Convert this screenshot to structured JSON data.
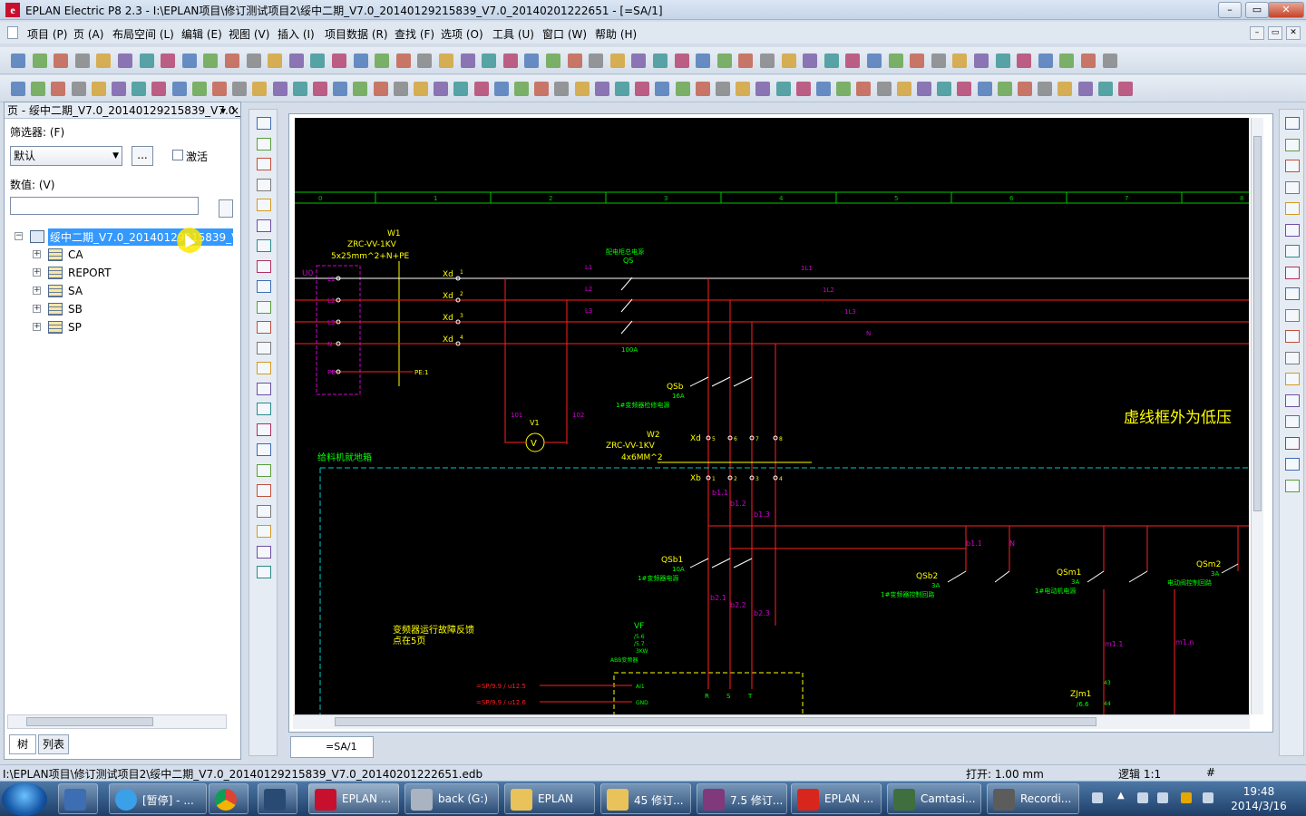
{
  "window": {
    "title": "EPLAN Electric P8 2.3 - I:\\EPLAN项目\\修订测试项目2\\绥中二期_V7.0_20140129215839_V7.0_20140201222651 - [=SA/1]"
  },
  "menu": [
    "项目 (P)",
    "页 (A)",
    "布局空间 (L)",
    "编辑 (E)",
    "视图 (V)",
    "插入 (I)",
    "项目数据 (R)",
    "查找 (F)",
    "选项 (O)",
    "工具 (U)",
    "窗口 (W)",
    "帮助 (H)"
  ],
  "panel": {
    "title": "页 - 绥中二期_V7.0_20140129215839_V7.0_20",
    "filter_label": "筛选器: (F)",
    "filter_value": "默认",
    "more_label": "...",
    "activate_label": "激活",
    "value_label": "数值: (V)",
    "tree_root": "绥中二期_V7.0_20140129215839_V7",
    "tree_items": [
      "CA",
      "REPORT",
      "SA",
      "SB",
      "SP"
    ],
    "tab_tree": "树",
    "tab_list": "列表"
  },
  "page_tab": "=SA/1",
  "status": {
    "path": "I:\\EPLAN项目\\修订测试项目2\\绥中二期_V7.0_20140129215839_V7.0_20140201222651.edb",
    "open": "打开: 1.00 mm",
    "logic": "逻辑 1:1",
    "hash": "#"
  },
  "taskbar": {
    "items": [
      "[暂停] - ...",
      "",
      "",
      "EPLAN ...",
      "back (G:)",
      "EPLAN",
      "45 修订...",
      "7.5 修订...",
      "EPLAN ...",
      "Camtasi...",
      "Recordi..."
    ],
    "time": "19:48",
    "date": "2014/3/16"
  },
  "schematic": {
    "grid_numbers": [
      "0",
      "1",
      "2",
      "3",
      "4",
      "5",
      "6",
      "7",
      "8"
    ],
    "cable_w1": [
      "W1",
      "ZRC-VV-1KV",
      "5x25mm^2+N+PE"
    ],
    "u0": "U0",
    "u0_terms": [
      "L1",
      "L2",
      "L3",
      "N",
      "PE"
    ],
    "xd_labels": [
      "Xd",
      "Xd",
      "Xd",
      "Xd"
    ],
    "xd_nums": [
      "1",
      "2",
      "3",
      "4"
    ],
    "pe_label": "PE:1",
    "qs_title": "配电柜总电源",
    "qs": "QS",
    "qs_rating": "100A",
    "phase_in": [
      "L1",
      "L2",
      "L3"
    ],
    "phase_out": [
      "1L1",
      "1L2",
      "1L3",
      "N"
    ],
    "qsb": "QSb",
    "qsb_rating": "16A",
    "qsb_desc": "1#变频器检修电源",
    "v1": "V1",
    "v_symbol": "V",
    "v_nums": [
      "101",
      "102"
    ],
    "w2": [
      "W2",
      "ZRC-VV-1KV",
      "4x6MM^2"
    ],
    "xd_row": "Xd",
    "xb_row": "Xb",
    "xd_row_nums": [
      "5",
      "6",
      "7",
      "8"
    ],
    "xb_row_nums": [
      "1",
      "2",
      "3",
      "4"
    ],
    "area_label": "给料机就地箱",
    "big_note": "虚线框外为低压",
    "b_labels": [
      "b1.1",
      "b1.2",
      "b1.3",
      "b1.1",
      "N",
      "b2.1",
      "b2.2",
      "b2.3"
    ],
    "qsb1": "QSb1",
    "qsb1_rating": "10A",
    "qsb1_desc": "1#变频器电源",
    "qsb2": "QSb2",
    "qsb2_rating": "3A",
    "qsb2_desc": "1#变频器控制回路",
    "qsm1": "QSm1",
    "qsm1_rating": "3A",
    "qsm1_desc": "1#电动机电源",
    "qsm2": "QSm2",
    "qsm2_rating": "3A",
    "qsm2_desc": "电动阀控制回路",
    "vf_note": [
      "变频器运行故障反馈",
      "点在5页"
    ],
    "vf": "VF",
    "vf_refs": [
      "/5.6",
      "/5.7",
      "3KW",
      "ABB变频器"
    ],
    "signals": [
      "=SP/9.9 / u12.5",
      "=SP/9.9 / u12.6"
    ],
    "vf_terms": [
      "AI1",
      "GND",
      "R",
      "S",
      "T"
    ],
    "m_labels": [
      "m1.1",
      "m1.n"
    ],
    "zjm1": "ZJm1",
    "zjm1_ref": "/6.6",
    "zjm1_pins": [
      "43",
      "44"
    ]
  }
}
